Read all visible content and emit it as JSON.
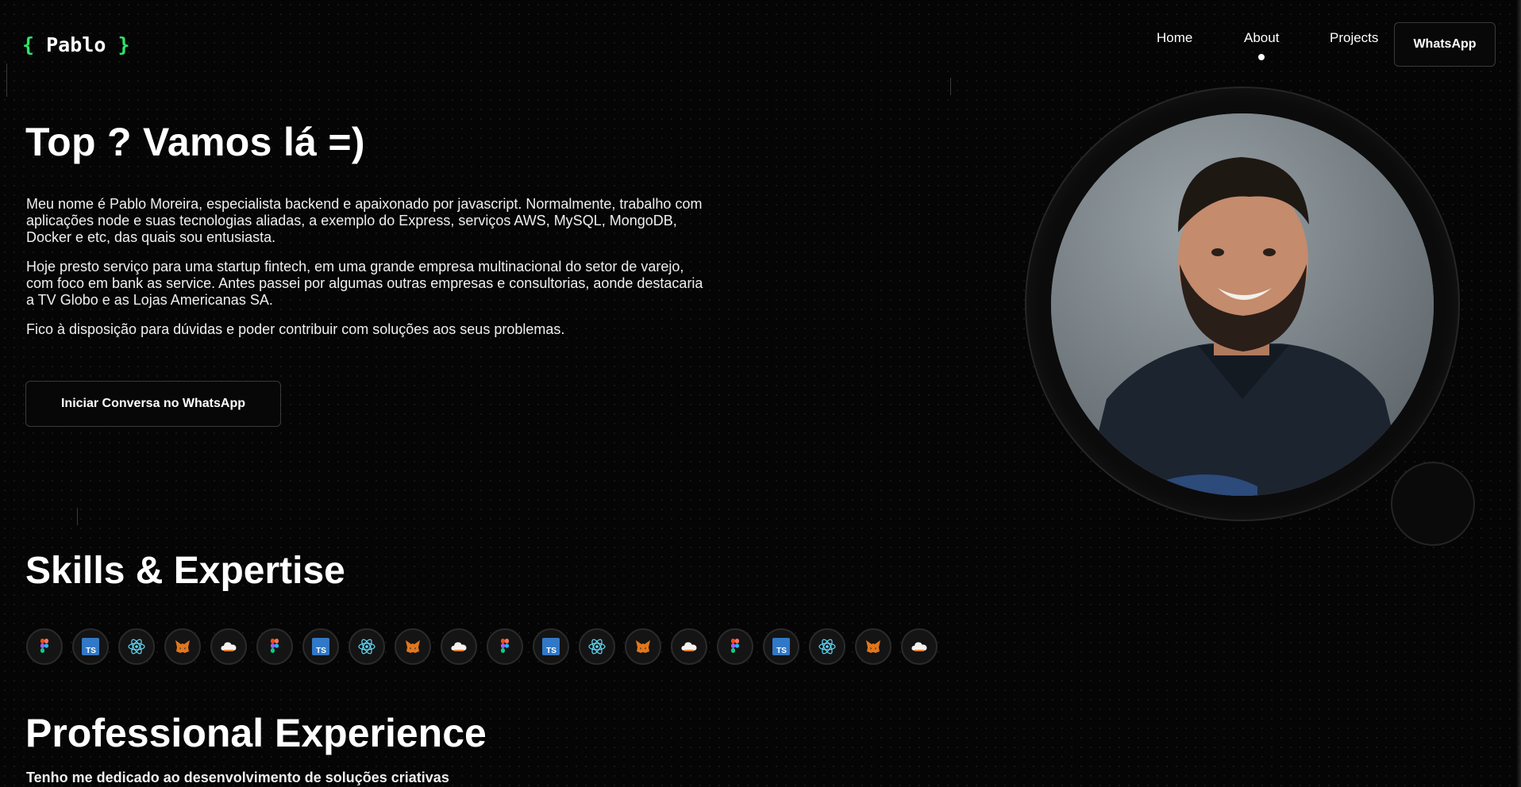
{
  "header": {
    "logo": {
      "brace_open": "{",
      "name": "Pablo",
      "brace_close": "}"
    },
    "nav": [
      {
        "label": "Home",
        "active": false
      },
      {
        "label": "About",
        "active": true
      },
      {
        "label": "Projects",
        "active": false
      }
    ],
    "whatsapp_button": "WhatsApp"
  },
  "hero": {
    "title": "Top ? Vamos lá =)",
    "paragraphs": [
      "Meu nome é Pablo Moreira, especialista backend e apaixonado por javascript. Normalmente, trabalho com aplicações node e suas tecnologias aliadas, a exemplo do Express, serviços AWS, MySQL, MongoDB, Docker e etc, das quais sou entusiasta.",
      "Hoje presto serviço para uma startup fintech, em uma grande empresa multinacional do setor de varejo, com foco em bank as service. Antes passei por algumas outras empresas e consultorias, aonde destacaria a TV Globo e as Lojas Americanas SA.",
      "Fico à disposição para dúvidas e poder contribuir com soluções aos seus problemas."
    ],
    "cta_label": "Iniciar Conversa no WhatsApp"
  },
  "skills": {
    "title": "Skills & Expertise",
    "icons": [
      "figma-icon",
      "typescript-icon",
      "react-icon",
      "metamask-icon",
      "cloud-icon",
      "figma-icon",
      "typescript-icon",
      "react-icon",
      "metamask-icon",
      "cloud-icon",
      "figma-icon",
      "typescript-icon",
      "react-icon",
      "metamask-icon",
      "cloud-icon",
      "figma-icon",
      "typescript-icon",
      "react-icon",
      "metamask-icon",
      "cloud-icon"
    ],
    "ts_text": "TS"
  },
  "experience": {
    "title": "Professional Experience",
    "subtitle": "Tenho me dedicado ao desenvolvimento de soluções criativas"
  },
  "colors": {
    "accent": "#2ee26d",
    "background": "#050505"
  }
}
